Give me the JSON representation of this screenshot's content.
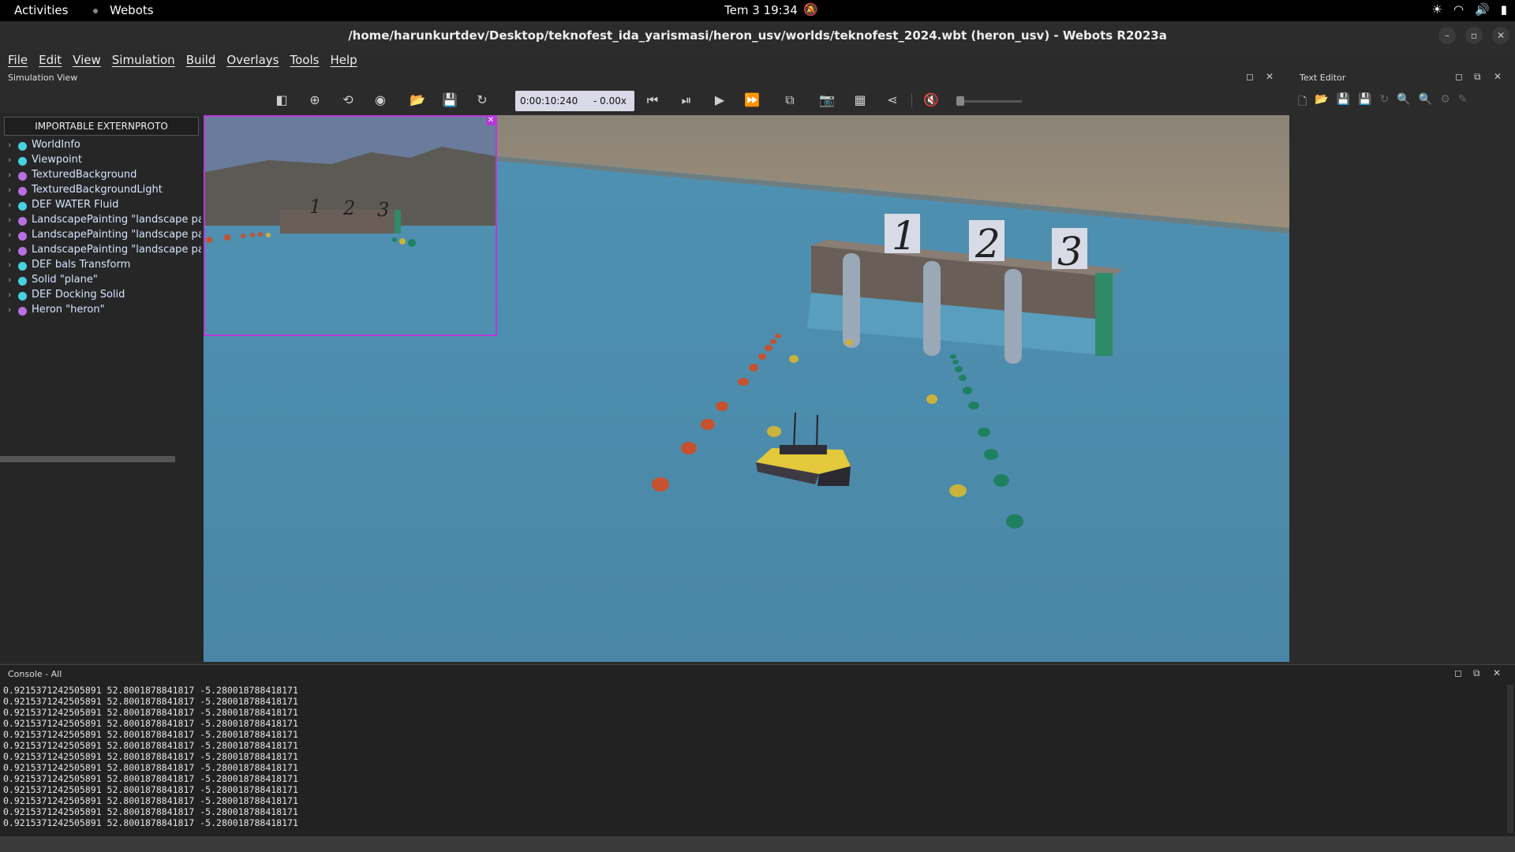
{
  "topbar": {
    "activities": "Activities",
    "app": "Webots",
    "clock": "Tem 3  19:34"
  },
  "window": {
    "title": "/home/harunkurtdev/Desktop/teknofest_ida_yarismasi/heron_usv/worlds/teknofest_2024.wbt (heron_usv) - Webots R2023a"
  },
  "menu": [
    "File",
    "Edit",
    "View",
    "Simulation",
    "Build",
    "Overlays",
    "Tools",
    "Help"
  ],
  "simulation_view": {
    "label": "Simulation View",
    "time": "0:00:10:240",
    "speed": "- 0.00x"
  },
  "scene_tree": {
    "externproto_button": "IMPORTABLE EXTERNPROTO",
    "items": [
      {
        "label": "WorldInfo",
        "color": "#48d1e0"
      },
      {
        "label": "Viewpoint",
        "color": "#48d1e0"
      },
      {
        "label": "TexturedBackground",
        "color": "#b870e0"
      },
      {
        "label": "TexturedBackgroundLight",
        "color": "#b870e0"
      },
      {
        "label": "DEF WATER Fluid",
        "color": "#48d1e0"
      },
      {
        "label": "LandscapePainting \"landscape painti",
        "color": "#b870e0"
      },
      {
        "label": "LandscapePainting \"landscape painti",
        "color": "#b870e0"
      },
      {
        "label": "LandscapePainting \"landscape painti",
        "color": "#b870e0"
      },
      {
        "label": "DEF bals Transform",
        "color": "#48d1e0"
      },
      {
        "label": "Solid \"plane\"",
        "color": "#48d1e0"
      },
      {
        "label": "DEF Docking Solid",
        "color": "#48d1e0"
      },
      {
        "label": "Heron \"heron\"",
        "color": "#b870e0"
      }
    ]
  },
  "scene_labels": {
    "dock1": "1",
    "dock2": "2",
    "dock3": "3"
  },
  "text_editor": {
    "label": "Text Editor"
  },
  "console": {
    "label": "Console - All",
    "lines": [
      "0.9215371242505891 52.8001878841817 -5.280018788418171",
      "0.9215371242505891 52.8001878841817 -5.280018788418171",
      "0.9215371242505891 52.8001878841817 -5.280018788418171",
      "0.9215371242505891 52.8001878841817 -5.280018788418171",
      "0.9215371242505891 52.8001878841817 -5.280018788418171",
      "0.9215371242505891 52.8001878841817 -5.280018788418171",
      "0.9215371242505891 52.8001878841817 -5.280018788418171",
      "0.9215371242505891 52.8001878841817 -5.280018788418171",
      "0.9215371242505891 52.8001878841817 -5.280018788418171",
      "0.9215371242505891 52.8001878841817 -5.280018788418171",
      "0.9215371242505891 52.8001878841817 -5.280018788418171",
      "0.9215371242505891 52.8001878841817 -5.280018788418171",
      "0.9215371242505891 52.8001878841817 -5.280018788418171"
    ]
  }
}
